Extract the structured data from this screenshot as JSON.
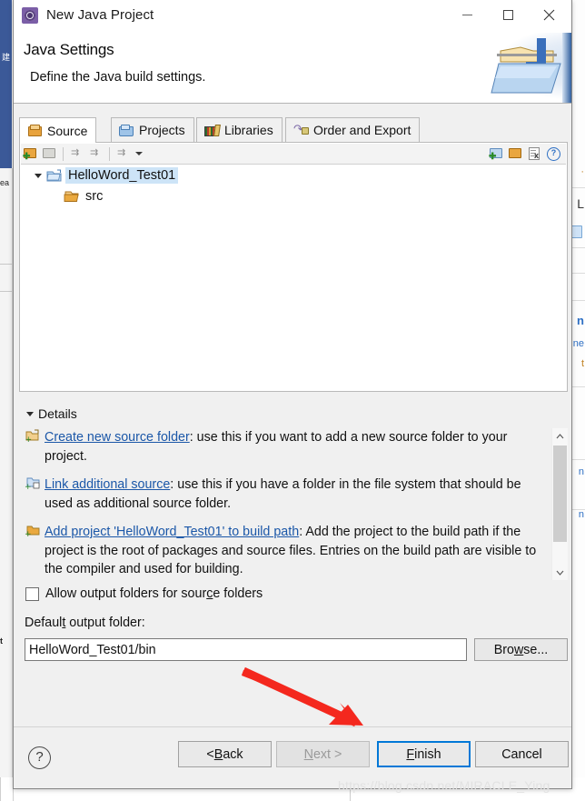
{
  "window": {
    "title": "New Java Project",
    "icon": "java-project-wizard-icon",
    "controls": {
      "minimize": "minimize-icon",
      "maximize": "maximize-icon",
      "close": "close-icon"
    }
  },
  "header": {
    "title": "Java Settings",
    "subtitle": "Define the Java build settings.",
    "banner_icon": "java-folder-banner-icon"
  },
  "tabs": [
    {
      "label": "Source",
      "icon": "source-folder-icon",
      "active": true
    },
    {
      "label": "Projects",
      "icon": "open-folder-icon",
      "active": false
    },
    {
      "label": "Libraries",
      "icon": "libraries-icon",
      "active": false
    },
    {
      "label": "Order and Export",
      "icon": "order-export-icon",
      "active": false
    }
  ],
  "tree_toolbar": {
    "left_buttons": [
      "add-source-folder-icon",
      "edit-source-folder-icon",
      "add-exclusion-icon",
      "add-inclusion-icon",
      "configure-output-icon"
    ],
    "dropdown": "chevron-down-icon",
    "right_buttons": [
      "link-source-icon",
      "add-folder-icon",
      "remove-icon",
      "help-icon"
    ]
  },
  "tree": {
    "nodes": [
      {
        "label": "HelloWord_Test01",
        "icon": "project-folder-icon",
        "selected": true,
        "expanded": true,
        "depth": 0
      },
      {
        "label": "src",
        "icon": "source-folder-icon",
        "selected": false,
        "expanded": false,
        "depth": 1
      }
    ]
  },
  "details": {
    "section_label": "Details",
    "items": [
      {
        "icon": "create-source-folder-icon",
        "link": "Create new source folder",
        "text": ": use this if you want to add a new source folder to your project."
      },
      {
        "icon": "link-source-icon",
        "link": "Link additional source",
        "text": ": use this if you have a folder in the file system that should be used as additional source folder."
      },
      {
        "icon": "add-project-build-path-icon",
        "link": "Add project 'HelloWord_Test01' to build path",
        "text": ": Add the project to the build path if the project is the root of packages and source files. Entries on the build path are visible to the compiler and used for building."
      }
    ],
    "scrollbar": {
      "up": "scroll-up-icon",
      "down": "scroll-down-icon"
    }
  },
  "options": {
    "allow_output_folders": {
      "label_before": "Allow output folders for sour",
      "label_mnemonic": "c",
      "label_after": "e folders",
      "checked": false
    }
  },
  "output_folder": {
    "label_before": "Defaul",
    "label_mnemonic": "t",
    "label_after": " output folder:",
    "value": "HelloWord_Test01/bin",
    "placeholder": "",
    "browse_before": "Bro",
    "browse_mnemonic": "w",
    "browse_after": "se..."
  },
  "footer": {
    "help": "?",
    "buttons": [
      {
        "id": "back",
        "before": "< ",
        "mnemonic": "B",
        "after": "ack",
        "state": "enabled"
      },
      {
        "id": "next",
        "before": "",
        "mnemonic": "N",
        "after": "ext >",
        "state": "disabled"
      },
      {
        "id": "finish",
        "before": "",
        "mnemonic": "F",
        "after": "inish",
        "state": "default"
      },
      {
        "id": "cancel",
        "before": "Cancel",
        "mnemonic": "",
        "after": "",
        "state": "enabled"
      }
    ]
  },
  "annotation": {
    "arrow": "red-arrow-pointing-to-finish",
    "color": "#f4281e"
  },
  "watermark": {
    "text": "https://blog.csdn.net/MIRACLE_Ying"
  },
  "background": {
    "left_rail_label": "建",
    "left_items": [
      "ea",
      "t"
    ],
    "right_items": [
      {
        "text": "L",
        "style": "dark"
      },
      {
        "text": "n",
        "style": "bold"
      },
      {
        "text": "ne",
        "style": "blue"
      },
      {
        "text": "t",
        "style": "orange"
      },
      {
        "text": "n",
        "style": "blue"
      },
      {
        "text": "n",
        "style": "blue"
      }
    ]
  }
}
